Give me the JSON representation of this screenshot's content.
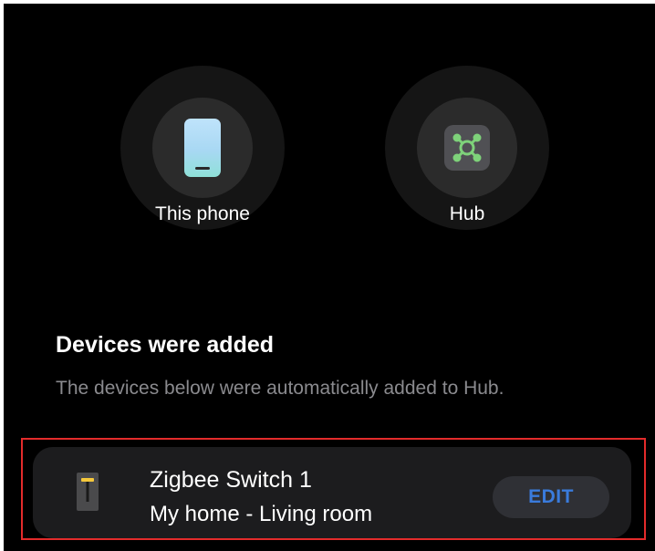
{
  "devices": {
    "phone": {
      "label": "This phone",
      "icon": "phone-icon"
    },
    "hub": {
      "label": "Hub",
      "icon": "hub-icon"
    }
  },
  "section": {
    "title": "Devices were added",
    "description": "The devices below were automatically added to Hub."
  },
  "added_device": {
    "name": "Zigbee Switch 1",
    "location": "My home - Living room",
    "icon": "switch-icon",
    "edit_label": "EDIT"
  },
  "colors": {
    "background": "#000000",
    "card": "#1c1c1e",
    "accent": "#3a7bdc",
    "highlight": "#e32b2b",
    "hub_green": "#7ed27a"
  }
}
